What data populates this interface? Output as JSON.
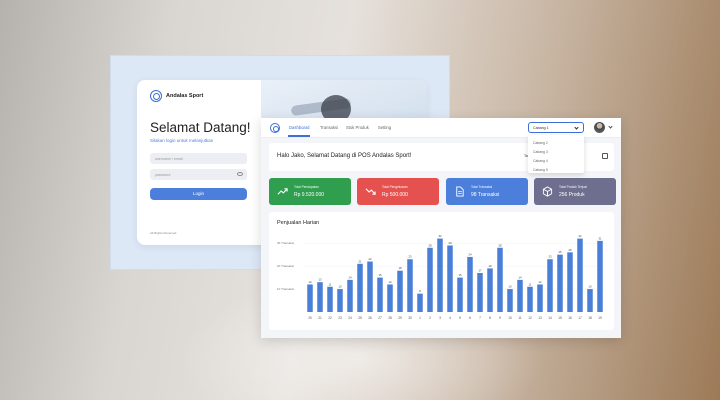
{
  "login": {
    "brand": "Andalas Sport",
    "welcome": "Selamat Datang!",
    "subtitle": "Silakan login untuk melanjutkan",
    "username_placeholder": "username / email",
    "password_placeholder": "password",
    "login_button": "Login",
    "copyright": "All Rights Reserved"
  },
  "dashboard": {
    "nav": [
      "Dashboard",
      "Transaksi",
      "Stok Produk",
      "Setting"
    ],
    "branch_select": "Cabang 1",
    "branch_options": [
      "Cabang 2",
      "Cabang 3",
      "Cabang 4",
      "Cabang 5"
    ],
    "greeting": "Halo Jako, Selamat Datang di POS Andalas Sport!",
    "date_label": "Tangg",
    "stats": [
      {
        "label": "Total Pendapatan",
        "value": "Rp 9.520.000",
        "color": "#2f9e4f",
        "icon": "trend-up-icon"
      },
      {
        "label": "Total Pengeluaran",
        "value": "Rp 500.000",
        "color": "#e5514f",
        "icon": "trend-down-icon"
      },
      {
        "label": "Total Transaksi",
        "value": "98 Transaksi",
        "color": "#4c7fdb",
        "icon": "document-icon"
      },
      {
        "label": "Total Produk Terjual",
        "value": "256 Produk",
        "color": "#6e6f8f",
        "icon": "box-icon"
      }
    ],
    "chart_title": "Penjualan Harian"
  },
  "chart_data": {
    "type": "bar",
    "title": "Penjualan Harian",
    "color": "#4a7fd8",
    "yticks": [
      "30 Transaksi",
      "20 Transaksi",
      "10 Transaksi"
    ],
    "ylim": [
      0,
      34
    ],
    "categories": [
      "20",
      "21",
      "22",
      "23",
      "24",
      "25",
      "26",
      "27",
      "28",
      "29",
      "30",
      "1",
      "2",
      "3",
      "4",
      "5",
      "6",
      "7",
      "8",
      "9",
      "10",
      "11",
      "12",
      "13",
      "14",
      "15",
      "16",
      "17",
      "18",
      "19"
    ],
    "values": [
      12,
      13,
      11,
      10,
      14,
      21,
      22,
      15,
      12,
      18,
      23,
      8,
      28,
      32,
      29,
      15,
      24,
      17,
      19,
      28,
      10,
      14,
      11,
      12,
      23,
      25,
      26,
      32,
      10,
      31
    ]
  }
}
